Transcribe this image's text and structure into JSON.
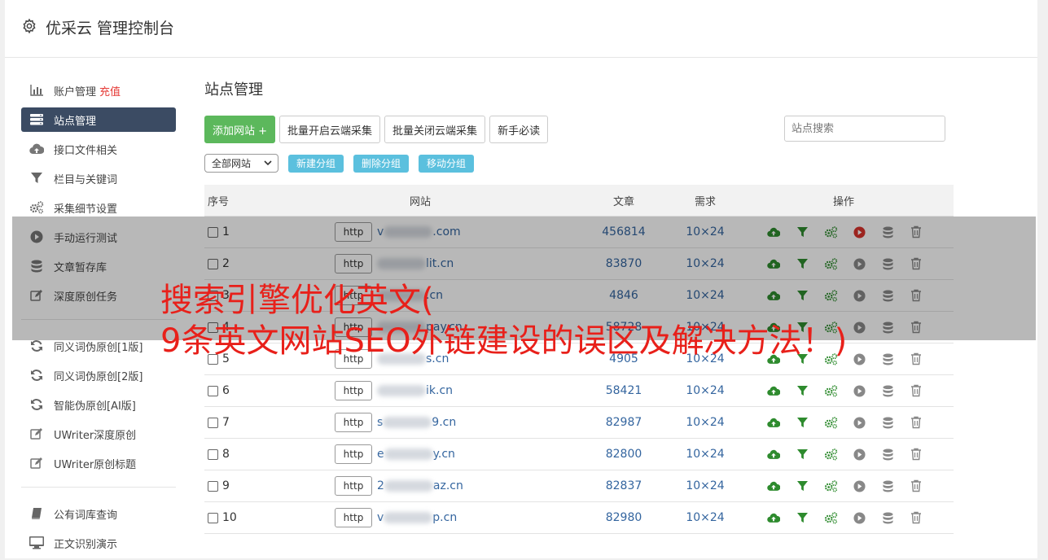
{
  "header": {
    "title": "优采云 管理控制台"
  },
  "sidebar": {
    "groups": [
      [
        {
          "label": "账户管理",
          "badge": "充值",
          "icon": "bar-chart-icon"
        },
        {
          "label": "站点管理",
          "icon": "server-icon",
          "active": true
        },
        {
          "label": "接口文件相关",
          "icon": "cloud-upload-icon"
        },
        {
          "label": "栏目与关键词",
          "icon": "filter-icon"
        },
        {
          "label": "采集细节设置",
          "icon": "gears-icon"
        },
        {
          "label": "手动运行测试",
          "icon": "play-icon"
        },
        {
          "label": "文章暂存库",
          "icon": "database-icon"
        },
        {
          "label": "深度原创任务",
          "icon": "edit-icon"
        }
      ],
      [
        {
          "label": "同义词伪原创[1版]",
          "icon": "refresh-icon"
        },
        {
          "label": "同义词伪原创[2版]",
          "icon": "refresh-icon"
        },
        {
          "label": "智能伪原创[AI版]",
          "icon": "refresh-icon"
        },
        {
          "label": "UWriter深度原创",
          "icon": "edit-icon"
        },
        {
          "label": "UWriter原创标题",
          "icon": "edit-icon"
        }
      ],
      [
        {
          "label": "公有词库查询",
          "icon": "book-icon"
        },
        {
          "label": "正文识别演示",
          "icon": "monitor-icon"
        }
      ]
    ]
  },
  "main": {
    "title": "站点管理",
    "toolbar": {
      "add_site": "添加网站 +",
      "batch_enable": "批量开启云端采集",
      "batch_disable": "批量关闭云端采集",
      "newbie": "新手必读"
    },
    "search_placeholder": "站点搜索",
    "group_select": "全部网站",
    "group_buttons": {
      "new": "新建分组",
      "delete": "删除分组",
      "move": "移动分组"
    },
    "table": {
      "headers": {
        "no": "序号",
        "site": "网站",
        "articles": "文章",
        "demand": "需求",
        "ops": "操作"
      },
      "rows": [
        {
          "no": "1",
          "proto": "http",
          "pre": "v",
          "post": ".com",
          "articles": "456814",
          "demand": "10×24",
          "playActive": true
        },
        {
          "no": "2",
          "proto": "http",
          "pre": "",
          "post": "lit.cn",
          "articles": "83870",
          "demand": "10×24"
        },
        {
          "no": "3",
          "proto": "http",
          "pre": "",
          "post": ".cn",
          "articles": "4846",
          "demand": "10×24"
        },
        {
          "no": "4",
          "proto": "http",
          "pre": "",
          "post": "pay.cn",
          "articles": "58728",
          "demand": "10×24"
        },
        {
          "no": "5",
          "proto": "http",
          "pre": "",
          "post": "s.cn",
          "articles": "4905",
          "demand": "10×24"
        },
        {
          "no": "6",
          "proto": "http",
          "pre": "",
          "post": "ik.cn",
          "articles": "58421",
          "demand": "10×24"
        },
        {
          "no": "7",
          "proto": "http",
          "pre": "s",
          "post": "9.cn",
          "articles": "82987",
          "demand": "10×24"
        },
        {
          "no": "8",
          "proto": "http",
          "pre": "e",
          "post": "y.cn",
          "articles": "82800",
          "demand": "10×24"
        },
        {
          "no": "9",
          "proto": "http",
          "pre": "2",
          "post": "az.cn",
          "articles": "82837",
          "demand": "10×24"
        },
        {
          "no": "10",
          "proto": "http",
          "pre": "v",
          "post": "p.cn",
          "articles": "82980",
          "demand": "10×24"
        }
      ]
    }
  },
  "overlay": {
    "line1": "搜索引擎优化英文(",
    "line2": "9条英文网站SEO外链建设的误区及解决方法！)"
  },
  "colors": {
    "active_nav": "#3b4b63",
    "green": "#5cb85c",
    "blue": "#5bc0de",
    "link": "#34659f",
    "overlay_text": "#e8201a"
  }
}
